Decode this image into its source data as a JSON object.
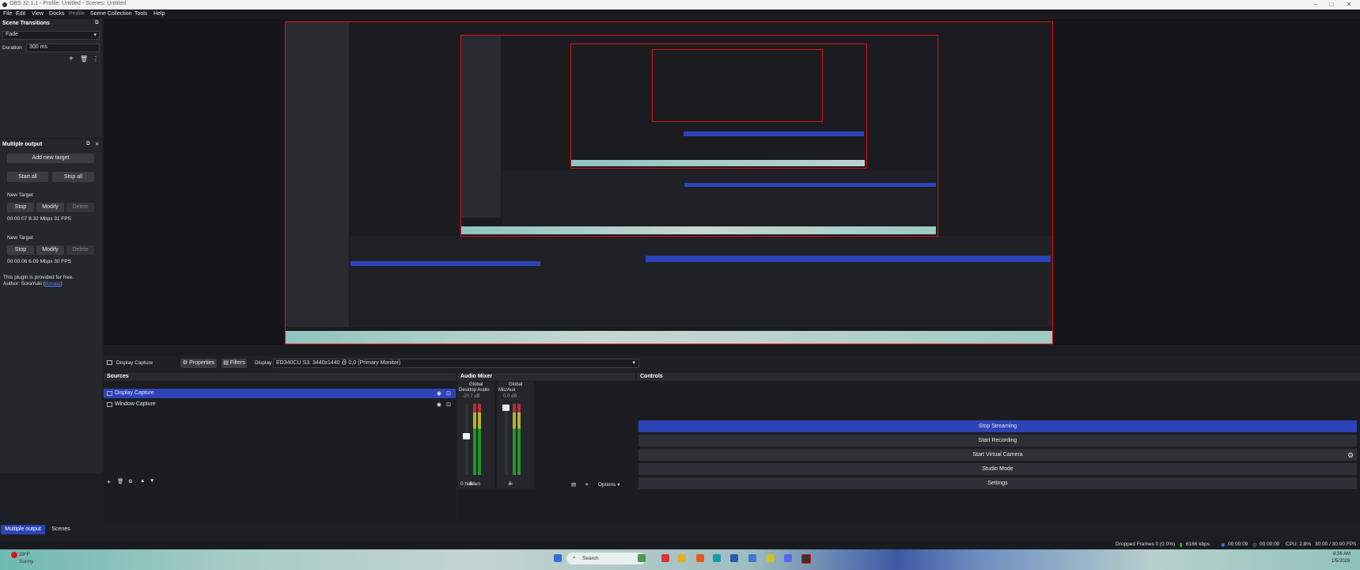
{
  "window": {
    "title": "OBS 32.1.1 - Profile: Untitled - Scenes: Untitled",
    "minimize": "–",
    "maximize": "□",
    "close": "✕"
  },
  "menu": [
    "File",
    "Edit",
    "View",
    "Docks",
    "Profile",
    "Scene Collection",
    "Tools",
    "Help"
  ],
  "transitions": {
    "title": "Scene Transitions",
    "selected": "Fade",
    "duration_label": "Duration",
    "duration_value": "300 ms"
  },
  "multiple_output": {
    "title": "Multiple output",
    "add_target": "Add new target",
    "start_all": "Start all",
    "stop_all": "Stop all",
    "targets": [
      {
        "name": "New Target",
        "stop": "Stop",
        "modify": "Modify",
        "delete": "Delete",
        "stats": "00:00:07  8.32 Mbps  31 FPS"
      },
      {
        "name": "New Target",
        "stop": "Stop",
        "modify": "Modify",
        "delete": "Delete",
        "stats": "00:00:06  6.09 Mbps  30 FPS"
      }
    ],
    "footer_line1": "This plugin is provided for free.",
    "footer_author": "Author: SoraYuki (",
    "footer_link": "donate",
    "footer_end": ")"
  },
  "context_bar": {
    "source": "Display Capture",
    "properties": "Properties",
    "filters": "Filters",
    "display_label": "Display",
    "display_value": "ED340CU S3: 3440x1440 @ 0,0 (Primary Monitor)"
  },
  "sources": {
    "title": "Sources",
    "items": [
      {
        "name": "Display Capture",
        "selected": true
      },
      {
        "name": "Window Capture",
        "selected": false
      }
    ]
  },
  "mixer": {
    "title": "Audio Mixer",
    "channels": [
      {
        "scope": "Global",
        "name": "Desktop Audio",
        "db": "-20.7 dB",
        "fader": 0.7
      },
      {
        "scope": "Global",
        "name": "Mic/Aux",
        "db": "0.0 dB",
        "fader": 1.0
      }
    ],
    "hidden": "0 hidden",
    "options": "Options"
  },
  "controls": {
    "title": "Controls",
    "buttons": [
      "Stop Streaming",
      "Start Recording",
      "Start Virtual Camera",
      "Studio Mode",
      "Settings"
    ]
  },
  "bottom_tabs": [
    "Multiple output",
    "Scenes"
  ],
  "status": {
    "dropped": "Dropped Frames 0 (0.0%)",
    "bitrate": "6166 kbps",
    "stream_time": "00:00:09",
    "rec_time": "00:00:00",
    "cpu": "CPU: 2.8%",
    "fps": "30.00 / 30.00 FPS"
  },
  "taskbar": {
    "weather_temp": "33°F",
    "weather_desc": "Sunny",
    "search": "Search",
    "time": "8:36 AM",
    "date": "1/5/2026"
  },
  "colors": {
    "accent": "#2d43b8",
    "canvas_border": "#dd1111",
    "background": "#1e1f24"
  }
}
